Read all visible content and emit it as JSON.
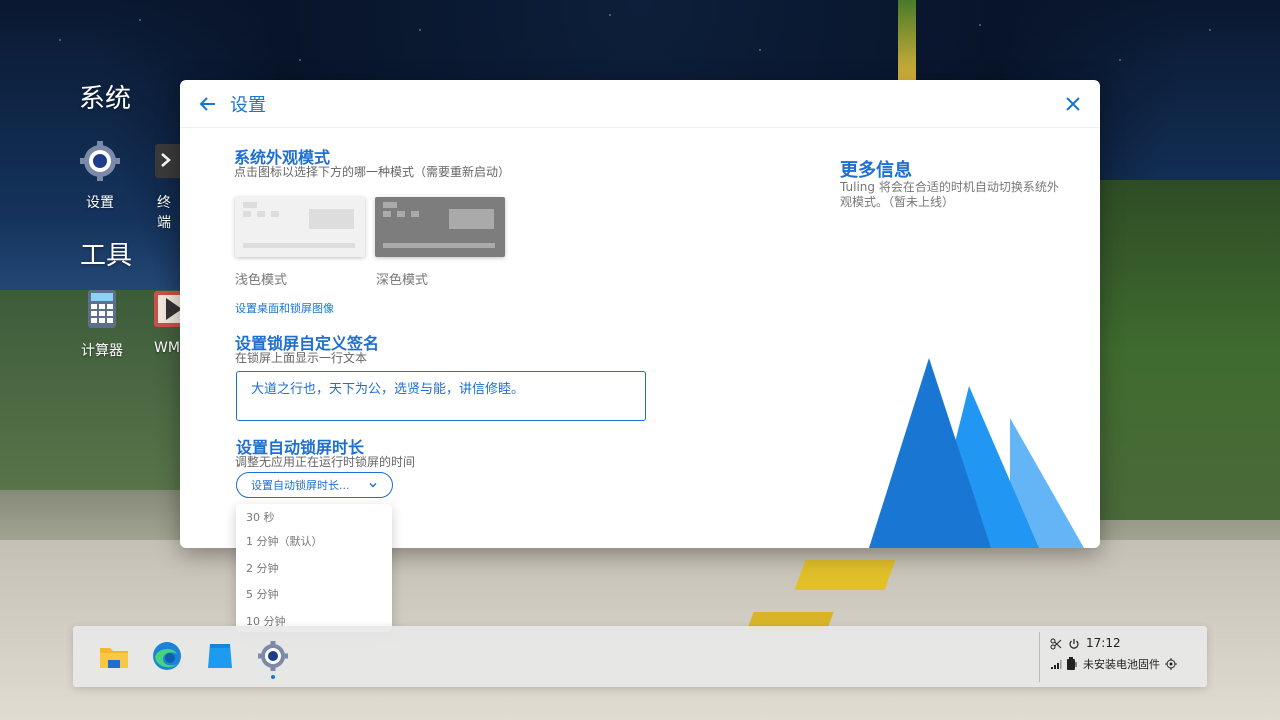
{
  "desktop": {
    "section_system": "系统",
    "section_tools": "工具",
    "icons": {
      "settings": "设置",
      "terminal": "终端",
      "calculator": "计算器",
      "wm": "WM"
    }
  },
  "window": {
    "title": "设置",
    "appearance": {
      "heading": "系统外观模式",
      "subtitle": "点击图标以选择下方的哪一种模式（需要重新启动）",
      "light_label": "浅色模式",
      "dark_label": "深色模式",
      "wallpaper_link": "设置桌面和锁屏图像"
    },
    "signature": {
      "heading": "设置锁屏自定义签名",
      "subtitle": "在锁屏上面显示一行文本",
      "value": "大道之行也，天下为公，选贤与能，讲信修睦。"
    },
    "lock_timeout": {
      "heading": "设置自动锁屏时长",
      "subtitle": "调整无应用正在运行时锁屏的时间",
      "select_placeholder": "设置自动锁屏时长...",
      "options": [
        "30 秒",
        "1 分钟（默认）",
        "2 分钟",
        "5 分钟",
        "10 分钟"
      ]
    },
    "more_info": {
      "heading": "更多信息",
      "text": "Tuling 将会在合适的时机自动切换系统外观模式。（暂未上线）"
    }
  },
  "taskbar": {
    "time": "17:12",
    "battery_status": "未安装电池固件"
  },
  "colors": {
    "accent": "#1976d2",
    "mountain_dark": "#1976d2",
    "mountain_mid": "#2196f3",
    "mountain_light": "#64b5f6"
  }
}
